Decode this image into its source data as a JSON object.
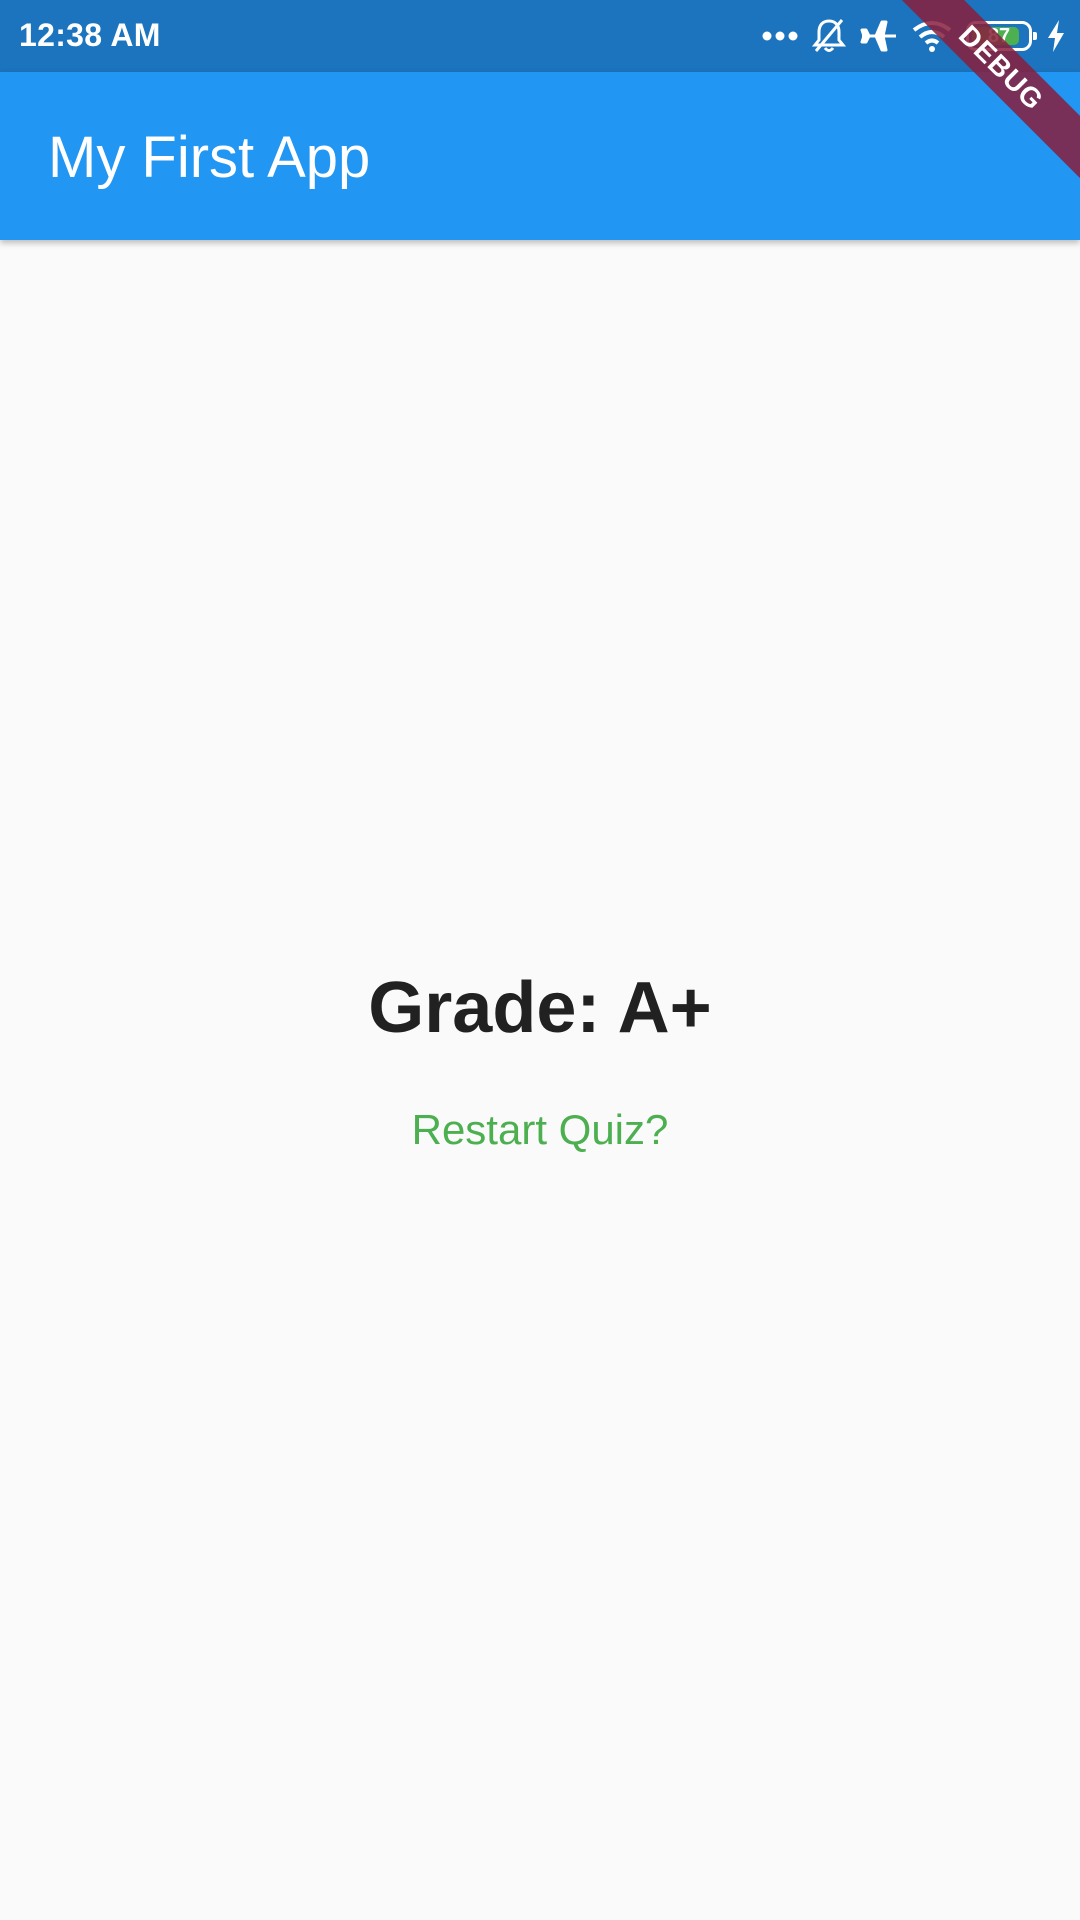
{
  "status_bar": {
    "time": "12:38 AM",
    "battery_level": "87",
    "battery_fraction": 0.87,
    "icons": [
      "more-dots-icon",
      "notifications-off-icon",
      "airplane-mode-icon",
      "wifi-icon",
      "battery-icon",
      "charging-bolt-icon"
    ]
  },
  "app_bar": {
    "title": "My First App"
  },
  "debug_banner": {
    "label": "DEBUG"
  },
  "result": {
    "grade": "Grade: A+",
    "restart_label": "Restart Quiz?"
  },
  "colors": {
    "status_bar": "#1b74bd",
    "app_bar": "#2196f3",
    "background": "#fafafa",
    "restart_text": "#4caf50",
    "grade_text": "#212121",
    "battery_fill": "#4caf50",
    "debug_banner": "#881e3c"
  }
}
